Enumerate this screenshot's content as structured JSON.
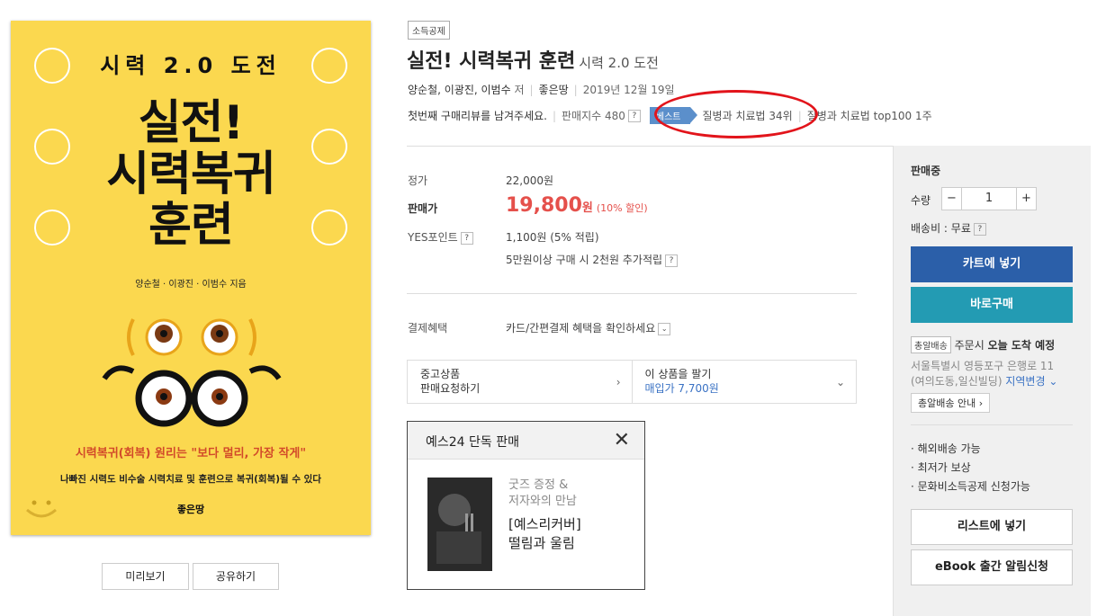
{
  "tag": "소득공제",
  "title": "실전! 시력복귀 훈련",
  "subtitle": "시력 2.0 도전",
  "meta": {
    "authors": "양순철, 이광진, 이범수",
    "author_role": "저",
    "publisher": "좋은땅",
    "date": "2019년 12월 19일"
  },
  "review": {
    "first_review": "첫번째 구매리뷰를 남겨주세요.",
    "sales_index": "판매지수 480",
    "help": "?",
    "best_badge": "베스트",
    "rank_text": "질병과 치료법 34위",
    "top_text": "질병과 치료법 top100 1주"
  },
  "cover": {
    "series": "시력 2.0 도전",
    "title_lines": [
      "실전!",
      "시력복귀",
      "훈련"
    ],
    "authors": "양순철 · 이광진 · 이범수 지음",
    "slogan": "시력복귀(회복) 원리는 \"보다 멀리, 가장 작게\"",
    "sub": "나빠진 시력도 비수술 시력치료 및 훈련으로 복귀(회복)될 수 있다",
    "publisher": "좋은땅"
  },
  "under_buttons": [
    "미리보기",
    "공유하기"
  ],
  "price": {
    "list_label": "정가",
    "list_value": "22,000원",
    "sale_label": "판매가",
    "sale_value": "19,800",
    "sale_unit": "원",
    "discount": "(10% 할인)",
    "point_label": "YES포인트",
    "point_value": "1,100원 (5% 적립)",
    "extra_point": "5만원이상 구매 시 2천원 추가적립",
    "pay_label": "결제혜택",
    "pay_value": "카드/간편결제 혜택을 확인하세요"
  },
  "used": {
    "left_line1": "중고상품",
    "left_line2": "판매요청하기",
    "right_line1": "이 상품을 팔기",
    "right_line2": "매입가 7,700원"
  },
  "exclusive": {
    "header": "예스24 단독 판매",
    "close": "✕",
    "line1a": "굿즈 증정 &",
    "line1b": "저자와의 만남",
    "line2a": "[예스리커버]",
    "line2b": "떨림과 울림"
  },
  "panel": {
    "status": "판매중",
    "qty_label": "수량",
    "qty_minus": "−",
    "qty_value": "1",
    "qty_plus": "+",
    "shipping": "배송비 : 무료",
    "cart": "카트에 넣기",
    "buy": "바로구매",
    "delivery_badge": "총알배송",
    "delivery_text_a": "주문시 ",
    "delivery_text_b": "오늘 도착 예정",
    "address1": "서울특별시 영등포구 은행로 11",
    "address2": "(여의도동,일신빌딩)",
    "region_change": "지역변경",
    "delivery_guide": "총알배송 안내",
    "bullets": [
      "해외배송 가능",
      "최저가 보상",
      "문화비소득공제 신청가능"
    ],
    "list_btn": "리스트에 넣기",
    "ebook_btn": "eBook 출간 알림신청"
  },
  "colors": {
    "price_red": "#e5504b",
    "cart_blue": "#2b5fa9",
    "buy_teal": "#239bb3",
    "best_blue": "#5b8fcb",
    "cover_yellow": "#fbd84f",
    "annotation_red": "#e2141b"
  }
}
